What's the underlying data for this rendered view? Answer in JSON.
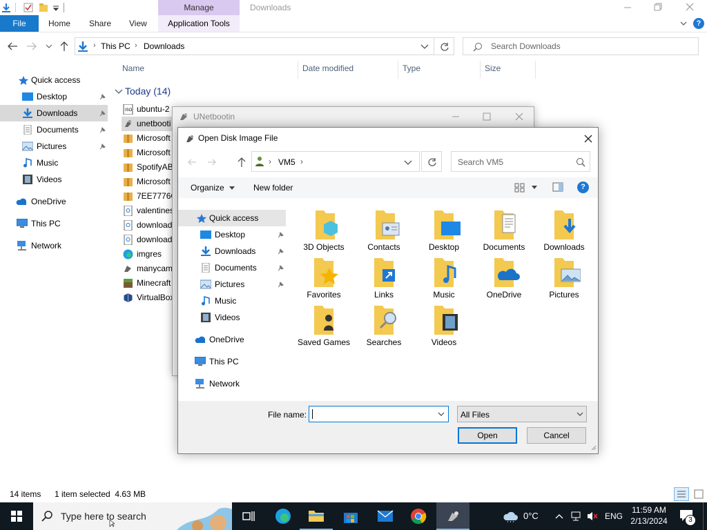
{
  "explorer": {
    "title": "Downloads",
    "manage_tab": "Manage",
    "tabs": {
      "file": "File",
      "home": "Home",
      "share": "Share",
      "view": "View",
      "app_tools": "Application Tools"
    },
    "breadcrumb": [
      "This PC",
      "Downloads"
    ],
    "search_placeholder": "Search Downloads",
    "columns": {
      "name": "Name",
      "date_modified": "Date modified",
      "type": "Type",
      "size": "Size"
    },
    "group_label": "Today (14)",
    "nav": {
      "quick_access": "Quick access",
      "items": [
        "Desktop",
        "Downloads",
        "Documents",
        "Pictures",
        "Music",
        "Videos"
      ],
      "onedrive": "OneDrive",
      "this_pc": "This PC",
      "network": "Network"
    },
    "files": [
      "ubuntu-2",
      "unetbooti",
      "Microsoft",
      "Microsoft",
      "SpotifyAB",
      "Microsoft",
      "7EE7776C",
      "valentines",
      "download",
      "download",
      "imgres",
      "manycam",
      "Minecraft",
      "VirtualBox"
    ],
    "status": {
      "count": "14 items",
      "selected": "1 item selected  4.63 MB"
    }
  },
  "unetbootin": {
    "title": "UNetbootin"
  },
  "dialog": {
    "title": "Open Disk Image File",
    "breadcrumb": [
      "VM5"
    ],
    "search_placeholder": "Search VM5",
    "organize": "Organize",
    "new_folder": "New folder",
    "nav": {
      "quick_access": "Quick access",
      "items": [
        "Desktop",
        "Downloads",
        "Documents",
        "Pictures",
        "Music",
        "Videos"
      ],
      "onedrive": "OneDrive",
      "this_pc": "This PC",
      "network": "Network"
    },
    "folders": [
      {
        "name": "3D Objects"
      },
      {
        "name": "Contacts"
      },
      {
        "name": "Desktop"
      },
      {
        "name": "Documents"
      },
      {
        "name": "Downloads"
      },
      {
        "name": "Favorites"
      },
      {
        "name": "Links"
      },
      {
        "name": "Music"
      },
      {
        "name": "OneDrive"
      },
      {
        "name": "Pictures"
      },
      {
        "name": "Saved Games"
      },
      {
        "name": "Searches"
      },
      {
        "name": "Videos"
      }
    ],
    "file_name_label": "File name:",
    "file_name_value": "",
    "file_type": "All Files",
    "open_label": "Open",
    "cancel_label": "Cancel"
  },
  "taskbar": {
    "search_placeholder": "Type here to search",
    "weather": "0°C",
    "language": "ENG",
    "time": "11:59 AM",
    "date": "2/13/2024",
    "notification_count": "3"
  },
  "colors": {
    "accent": "#0078d7",
    "folder": "#f3c94f",
    "taskbar": "#101820",
    "manage": "#d9c8ef"
  }
}
